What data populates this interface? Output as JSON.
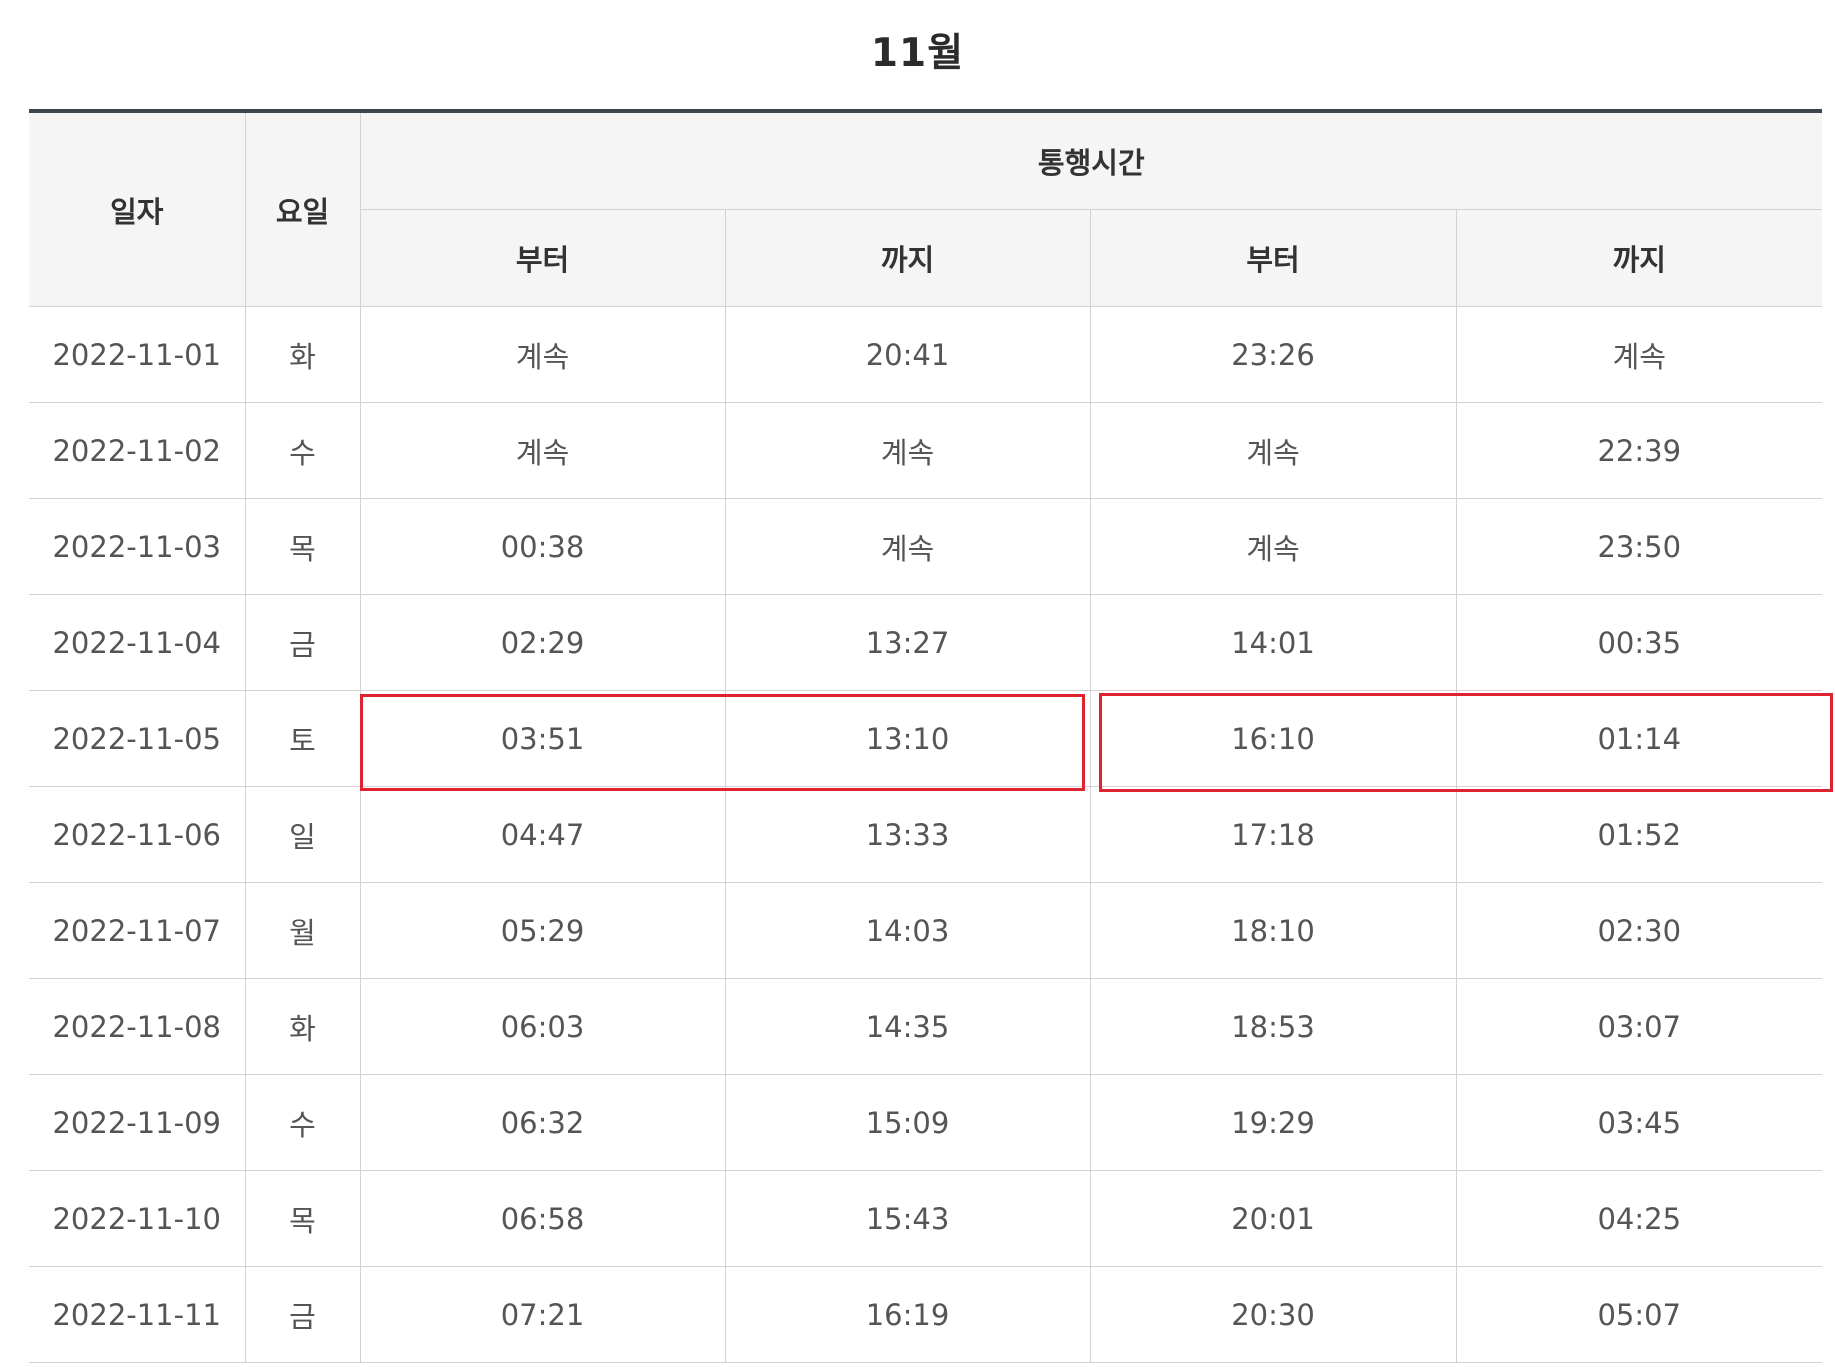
{
  "title": "11월",
  "header": {
    "date": "일자",
    "weekday": "요일",
    "passage_time": "통행시간",
    "from_1": "부터",
    "to_1": "까지",
    "from_2": "부터",
    "to_2": "까지"
  },
  "rows": [
    {
      "date": "2022-11-01",
      "weekday": "화",
      "from_1": "계속",
      "to_1": "20:41",
      "from_2": "23:26",
      "to_2": "계속"
    },
    {
      "date": "2022-11-02",
      "weekday": "수",
      "from_1": "계속",
      "to_1": "계속",
      "from_2": "계속",
      "to_2": "22:39"
    },
    {
      "date": "2022-11-03",
      "weekday": "목",
      "from_1": "00:38",
      "to_1": "계속",
      "from_2": "계속",
      "to_2": "23:50"
    },
    {
      "date": "2022-11-04",
      "weekday": "금",
      "from_1": "02:29",
      "to_1": "13:27",
      "from_2": "14:01",
      "to_2": "00:35"
    },
    {
      "date": "2022-11-05",
      "weekday": "토",
      "from_1": "03:51",
      "to_1": "13:10",
      "from_2": "16:10",
      "to_2": "01:14"
    },
    {
      "date": "2022-11-06",
      "weekday": "일",
      "from_1": "04:47",
      "to_1": "13:33",
      "from_2": "17:18",
      "to_2": "01:52"
    },
    {
      "date": "2022-11-07",
      "weekday": "월",
      "from_1": "05:29",
      "to_1": "14:03",
      "from_2": "18:10",
      "to_2": "02:30"
    },
    {
      "date": "2022-11-08",
      "weekday": "화",
      "from_1": "06:03",
      "to_1": "14:35",
      "from_2": "18:53",
      "to_2": "03:07"
    },
    {
      "date": "2022-11-09",
      "weekday": "수",
      "from_1": "06:32",
      "to_1": "15:09",
      "from_2": "19:29",
      "to_2": "03:45"
    },
    {
      "date": "2022-11-10",
      "weekday": "목",
      "from_1": "06:58",
      "to_1": "15:43",
      "from_2": "20:01",
      "to_2": "04:25"
    },
    {
      "date": "2022-11-11",
      "weekday": "금",
      "from_1": "07:21",
      "to_1": "16:19",
      "from_2": "20:30",
      "to_2": "05:07"
    }
  ],
  "colors": {
    "highlight": "#e0242f",
    "header_bg": "#f5f5f5",
    "top_rule": "#3a4550"
  }
}
